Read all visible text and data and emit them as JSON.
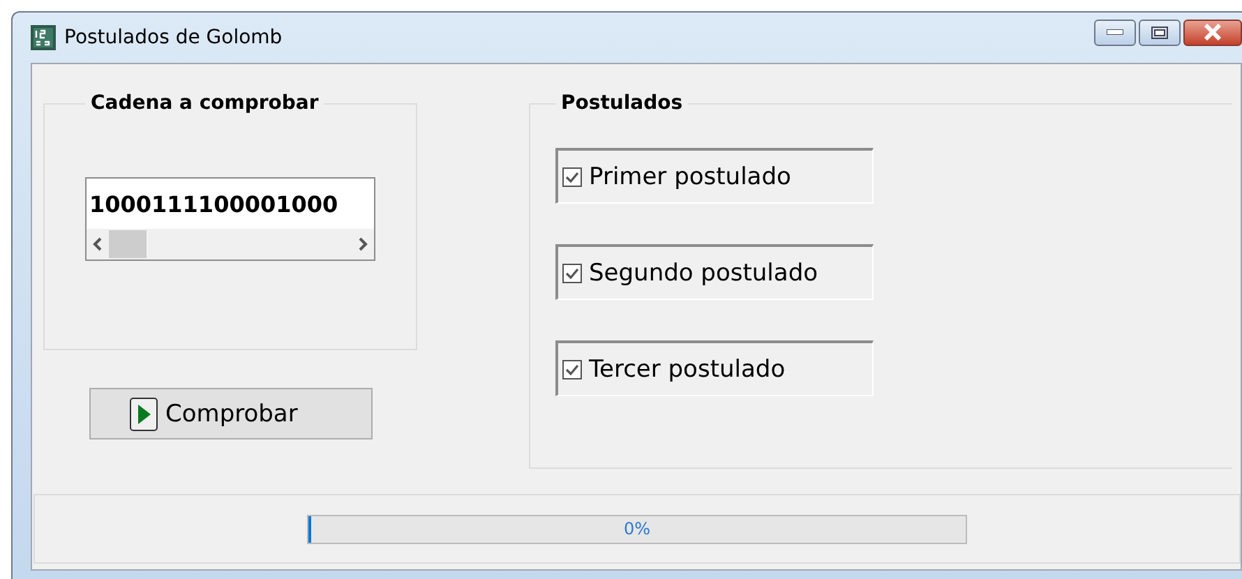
{
  "window": {
    "title": "Postulados de Golomb"
  },
  "input_group": {
    "title": "Cadena a comprobar",
    "value": "1000111100001000"
  },
  "check_button": {
    "label": "Comprobar"
  },
  "postulates_group": {
    "title": "Postulados",
    "items": [
      {
        "label": "Primer postulado",
        "checked": true
      },
      {
        "label": "Segundo postulado",
        "checked": true
      },
      {
        "label": "Tercer postulado",
        "checked": true
      }
    ]
  },
  "progress": {
    "level": 0,
    "reading": "0%"
  }
}
